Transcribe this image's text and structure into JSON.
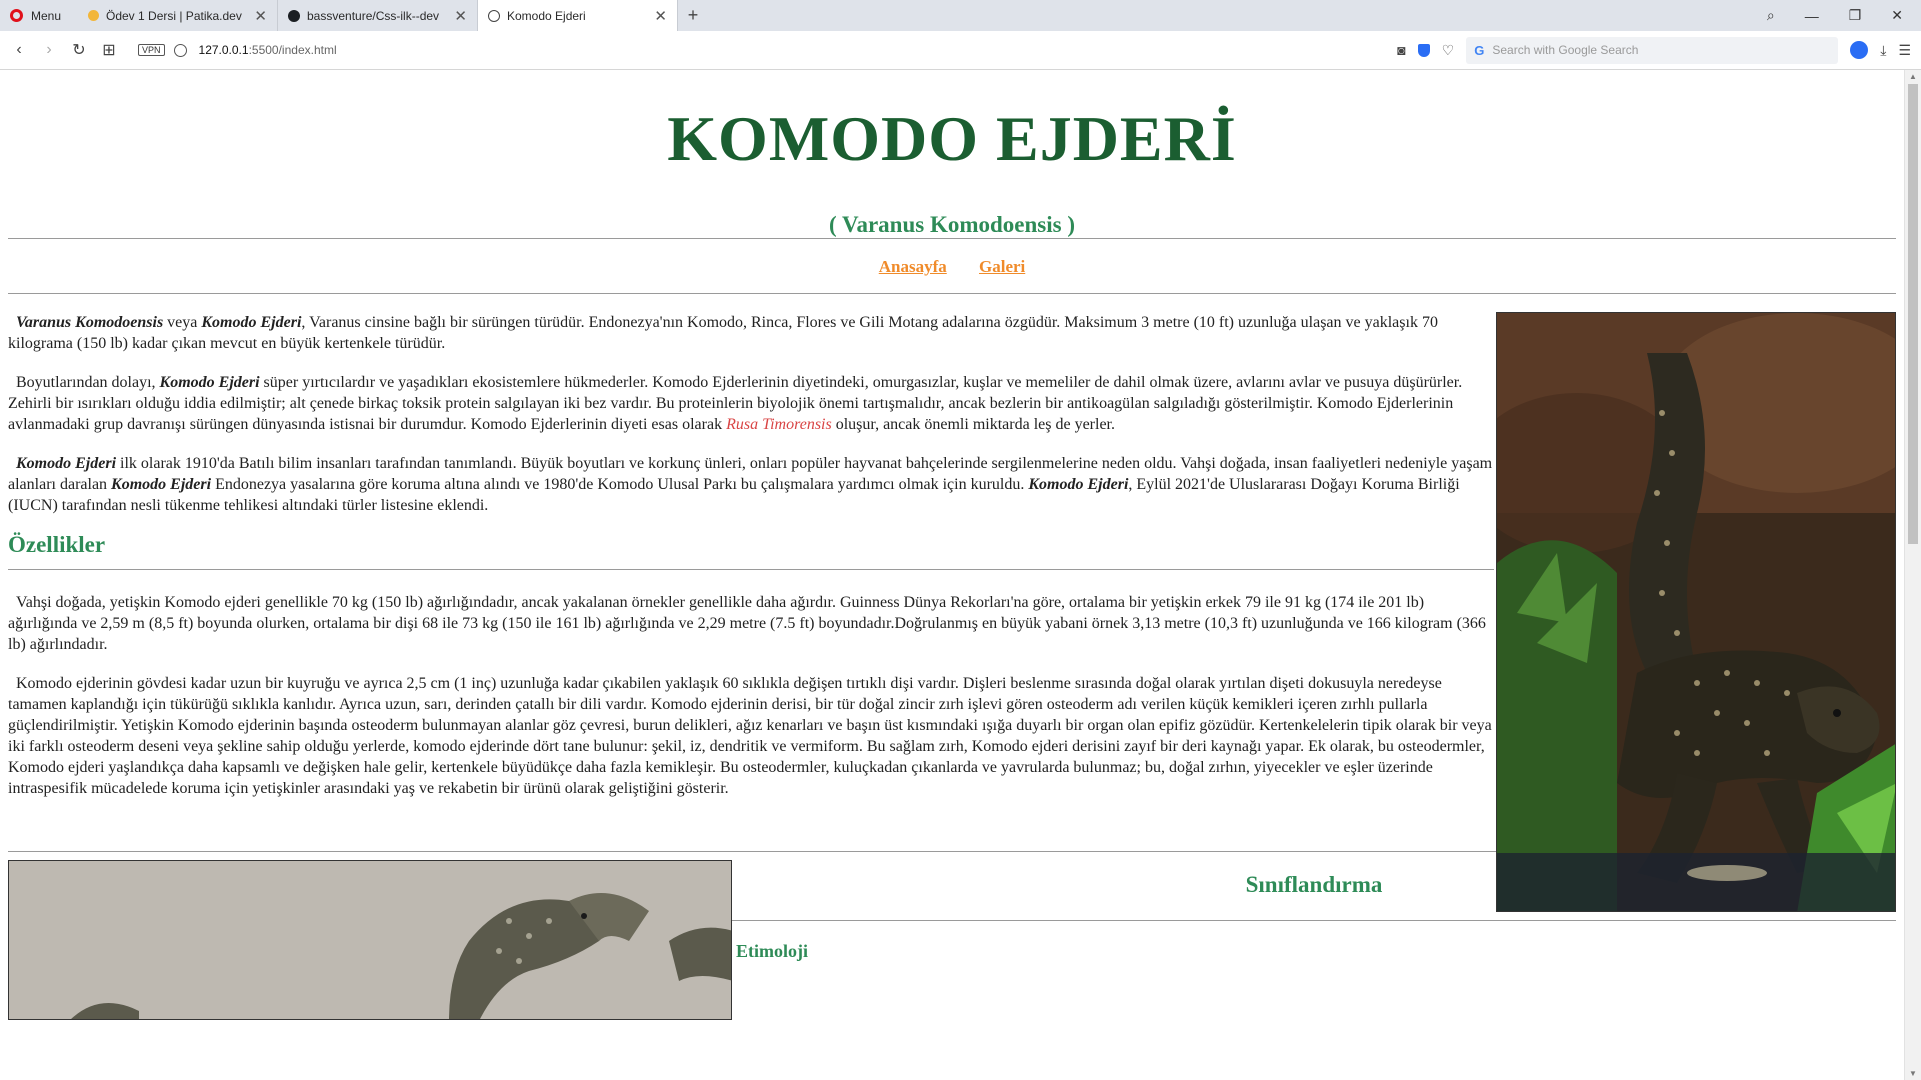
{
  "browser": {
    "menu_label": "Menu",
    "tabs": [
      {
        "label": "Ödev 1 Dersi | Patika.dev",
        "favicon": "patika-dot-icon"
      },
      {
        "label": "bassventure/Css-ilk--dev",
        "favicon": "github-icon"
      },
      {
        "label": "Komodo Ejderi",
        "favicon": "globe-icon",
        "active": true
      }
    ],
    "url_host": "127.0.0.1",
    "url_rest": ":5500/index.html",
    "vpn_label": "VPN",
    "search_placeholder": "Search with Google Search"
  },
  "page": {
    "title": "KOMODO EJDERİ",
    "subtitle": "( Varanus Komodoensis )",
    "nav": [
      "Anasayfa",
      "Galeri"
    ],
    "intro": {
      "p1": {
        "b1": "Varanus Komodoensis",
        "t1": " veya ",
        "b2": "Komodo Ejderi",
        "t2": ", Varanus cinsine bağlı bir sürüngen türüdür. Endonezya'nın Komodo, Rinca, Flores ve Gili Motang adalarına özgüdür. Maksimum 3 metre (10 ft) uzunluğa ulaşan ve yaklaşık 70 kilograma (150 lb) kadar çıkan mevcut en büyük kertenkele türüdür."
      },
      "p2": {
        "t1": "Boyutlarından dolayı, ",
        "b1": "Komodo Ejderi",
        "t2": " süper yırtıcılardır ve yaşadıkları ekosistemlere hükmederler. Komodo Ejderlerinin diyetindeki, omurgasızlar, kuşlar ve memeliler de dahil olmak üzere, avlarını avlar ve pusuya düşürürler. Zehirli bir ısırıkları olduğu iddia edilmiştir; alt çenede birkaç toksik protein salgılayan iki bez vardır. Bu proteinlerin biyolojik önemi tartışmalıdır, ancak bezlerin bir antikoagülan salgıladığı gösterilmiştir. Komodo Ejderlerinin avlanmadaki grup davranışı sürüngen dünyasında istisnai bir durumdur. Komodo Ejderlerinin diyeti esas olarak ",
        "red": "Rusa Timorensis",
        "t3": " oluşur, ancak önemli miktarda leş de yerler."
      },
      "p3": {
        "b1": "Komodo Ejderi",
        "t1": " ilk olarak 1910'da Batılı bilim insanları tarafından tanımlandı. Büyük boyutları ve korkunç ünleri, onları popüler hayvanat bahçelerinde sergilenmelerine neden oldu. Vahşi doğada, insan faaliyetleri nedeniyle yaşam alanları daralan ",
        "b2": "Komodo Ejderi",
        "t2": " Endonezya yasalarına göre koruma altına alındı ve 1980'de Komodo Ulusal Parkı bu çalışmalara yardımcı olmak için kuruldu. ",
        "b3": "Komodo Ejderi",
        "t3": ", Eylül 2021'de Uluslararası Doğayı Koruma Birliği (IUCN) tarafından nesli tükenme tehlikesi altındaki türler listesine eklendi."
      }
    },
    "features": {
      "heading": "Özellikler",
      "p1": "Vahşi doğada, yetişkin Komodo ejderi genellikle 70 kg (150 lb) ağırlığındadır, ancak yakalanan örnekler genellikle daha ağırdır. Guinness Dünya Rekorları'na göre, ortalama bir yetişkin erkek 79 ile 91 kg (174 ile 201 lb) ağırlığında ve 2,59 m (8,5 ft) boyunda olurken, ortalama bir dişi 68 ile 73 kg (150 ile 161 lb) ağırlığında ve 2,29 metre (7.5 ft) boyundadır.Doğrulanmış en büyük yabani örnek 3,13 metre (10,3 ft) uzunluğunda ve 166 kilogram (366 lb) ağırlındadır.",
      "p2": "Komodo ejderinin gövdesi kadar uzun bir kuyruğu ve ayrıca 2,5 cm (1 inç) uzunluğa kadar çıkabilen yaklaşık 60 sıklıkla değişen tırtıklı dişi vardır. Dişleri beslenme sırasında doğal olarak yırtılan dişeti dokusuyla neredeyse tamamen kaplandığı için tükürüğü sıklıkla kanlıdır. Ayrıca uzun, sarı, derinden çatallı bir dili vardır. Komodo ejderinin derisi, bir tür doğal zincir zırh işlevi gören osteoderm adı verilen küçük kemikleri içeren zırhlı pullarla güçlendirilmiştir. Yetişkin Komodo ejderinin başında osteoderm bulunmayan alanlar göz çevresi, burun delikleri, ağız kenarları ve başın üst kısmındaki ışığa duyarlı bir organ olan epifiz gözüdür. Kertenkelelerin tipik olarak bir veya iki farklı osteoderm deseni veya şekline sahip olduğu yerlerde, komodo ejderinde dört tane bulunur: şekil, iz, dendritik ve vermiform. Bu sağlam zırh, Komodo ejderi derisini zayıf bir deri kaynağı yapar. Ek olarak, bu osteodermler, Komodo ejderi yaşlandıkça daha kapsamlı ve değişken hale gelir, kertenkele büyüdükçe daha fazla kemikleşir. Bu osteodermler, kuluçkadan çıkanlarda ve yavrularda bulunmaz; bu, doğal zırhın, yiyecekler ve eşler üzerinde intraspesifik mücadelede koruma için yetişkinler arasındaki yaş ve rekabetin bir ürünü olarak geliştiğini gösterir."
    },
    "classification": {
      "heading": "Sınıflandırma",
      "subheading": "Etimoloji"
    }
  },
  "colors": {
    "title_green": "#1b5e31",
    "accent_green": "#2e8b57",
    "nav_orange": "#f08b2a",
    "species_red": "#d94545"
  }
}
